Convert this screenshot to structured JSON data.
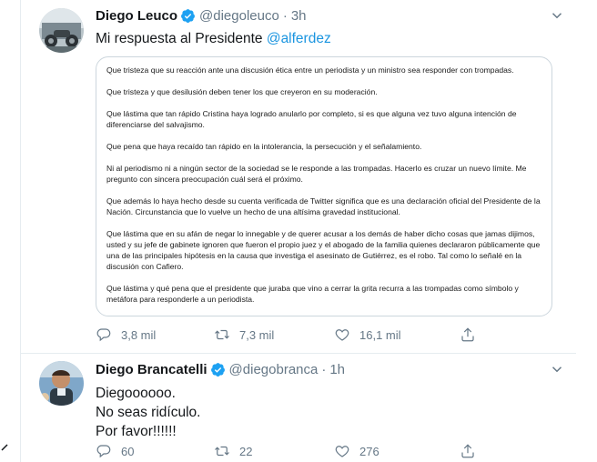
{
  "colors": {
    "accent": "#1b95e0",
    "verified": "#1da1f2",
    "secondary_text": "#657786",
    "primary_text": "#14171a",
    "divider": "#e6ecf0"
  },
  "tweets": [
    {
      "display_name": "Diego Leuco",
      "handle": "@diegoleuco",
      "separator": "·",
      "time": "3h",
      "text_prefix": "Mi respuesta al Presidente ",
      "mention": "@alferdez",
      "statement_paragraphs": [
        "Que tristeza que su reacción ante una discusión ética entre un periodista y un ministro sea responder con trompadas.",
        "Que tristeza y que desilusión deben tener los que creyeron en su moderación.",
        "Que lástima que tan rápido Cristina haya logrado anularlo por completo, si es que alguna vez tuvo alguna intención de diferenciarse del salvajismo.",
        "Que pena que haya recaído tan rápido en la intolerancia, la persecución y el señalamiento.",
        "Ni al periodismo ni a ningún sector de la sociedad se le responde a las trompadas. Hacerlo es cruzar un nuevo límite. Me pregunto con sincera preocupación cuál será el próximo.",
        "Que además lo haya hecho desde su cuenta verificada de Twitter significa que es una declaración oficial del Presidente de la Nación. Circunstancia que lo vuelve un hecho de una altísima gravedad institucional.",
        "Que lástima que en su afán de negar lo innegable y de querer acusar a los demás de haber dicho cosas que jamas dijimos, usted y su jefe de gabinete ignoren que fueron el propio juez y el abogado de la familia quienes declararon públicamente que una de las principales hipótesis en la causa que investiga el asesinato de Gutiérrez, es el robo. Tal como lo señalé en la discusión con Cafiero.",
        "Que lástima y qué pena que el presidente que juraba que vino a cerrar la grita recurra a las trompadas como símbolo y metáfora para responderle a un periodista."
      ],
      "replies": "",
      "retweets": "7,3 mil",
      "likes": "16,1 mil",
      "reply_count": "3,8 mil"
    },
    {
      "display_name": "Diego Brancatelli",
      "handle": "@diegobranca",
      "separator": "·",
      "time": "1h",
      "lines": [
        "Diegoooooo.",
        "No seas ridículo.",
        "Por favor!!!!!!"
      ],
      "reply_count": "60",
      "retweets": "22",
      "likes": "276"
    }
  ],
  "icons": {
    "verified": "verified-badge-icon",
    "caret": "chevron-down-icon",
    "reply": "reply-icon",
    "retweet": "retweet-icon",
    "like": "heart-icon",
    "share": "share-icon"
  }
}
